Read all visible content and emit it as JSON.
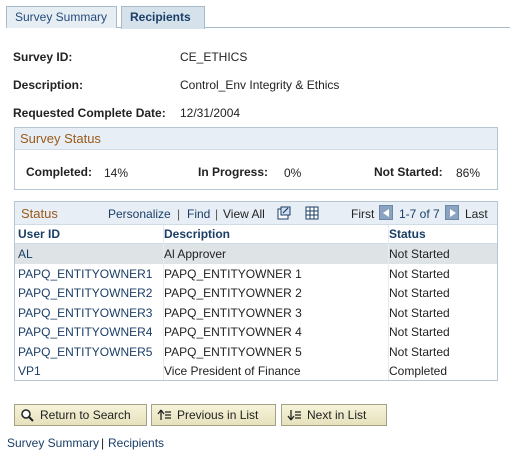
{
  "tabs": [
    {
      "label": "Survey Summary",
      "active": false
    },
    {
      "label": "Recipients",
      "active": true
    }
  ],
  "fields": {
    "survey_id_label": "Survey ID:",
    "survey_id_value": "CE_ETHICS",
    "description_label": "Description:",
    "description_value": "Control_Env Integrity & Ethics",
    "requested_date_label": "Requested Complete Date:",
    "requested_date_value": "12/31/2004"
  },
  "survey_status": {
    "title": "Survey Status",
    "completed_label": "Completed:",
    "completed_value": "14%",
    "in_progress_label": "In Progress:",
    "in_progress_value": "0%",
    "not_started_label": "Not Started:",
    "not_started_value": "86%"
  },
  "grid": {
    "title": "Status",
    "personalize": "Personalize",
    "find": "Find",
    "view_all": "View All",
    "sep": "|",
    "first": "First",
    "range": "1-7 of 7",
    "last": "Last",
    "columns": [
      "User ID",
      "Description",
      "Status"
    ],
    "rows": [
      {
        "user_id": "AL",
        "description": "Al Approver",
        "status": "Not Started"
      },
      {
        "user_id": "PAPQ_ENTITYOWNER1",
        "description": "PAPQ_ENTITYOWNER 1",
        "status": "Not Started"
      },
      {
        "user_id": "PAPQ_ENTITYOWNER2",
        "description": "PAPQ_ENTITYOWNER 2",
        "status": "Not Started"
      },
      {
        "user_id": "PAPQ_ENTITYOWNER3",
        "description": "PAPQ_ENTITYOWNER 3",
        "status": "Not Started"
      },
      {
        "user_id": "PAPQ_ENTITYOWNER4",
        "description": "PAPQ_ENTITYOWNER 4",
        "status": "Not Started"
      },
      {
        "user_id": "PAPQ_ENTITYOWNER5",
        "description": "PAPQ_ENTITYOWNER 5",
        "status": "Not Started"
      },
      {
        "user_id": "VP1",
        "description": "Vice President of Finance",
        "status": "Completed"
      }
    ]
  },
  "buttons": {
    "return_to_search": "Return to Search",
    "previous_in_list": "Previous in List",
    "next_in_list": "Next in List"
  },
  "footer": {
    "survey_summary": "Survey Summary",
    "sep": "|",
    "recipients": "Recipients"
  },
  "colors": {
    "link": "#1b3e67",
    "section_title": "#9b5a1b",
    "header_bg": "#e7eef5",
    "selected_row": "#dee3e6"
  }
}
